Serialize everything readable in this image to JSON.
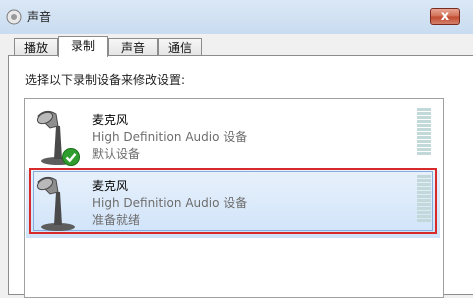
{
  "window": {
    "title": "声音",
    "close_label": "x"
  },
  "tabs": [
    {
      "label": "播放",
      "active": false
    },
    {
      "label": "录制",
      "active": true
    },
    {
      "label": "声音",
      "active": false
    },
    {
      "label": "通信",
      "active": false
    }
  ],
  "instruction": "选择以下录制设备来修改设置:",
  "devices": [
    {
      "name": "麦克风",
      "description": "High Definition Audio 设备",
      "status": "默认设备",
      "is_default": true,
      "selected": false
    },
    {
      "name": "麦克风",
      "description": "High Definition Audio 设备",
      "status": "准备就绪",
      "is_default": false,
      "selected": true
    }
  ],
  "icons": {
    "window": "speaker-icon",
    "device": "microphone-icon",
    "default_badge": "checkmark-icon"
  },
  "colors": {
    "selection_outline": "#d82a2a",
    "meter": "#c3d8d9",
    "check": "#2f9e2f"
  }
}
